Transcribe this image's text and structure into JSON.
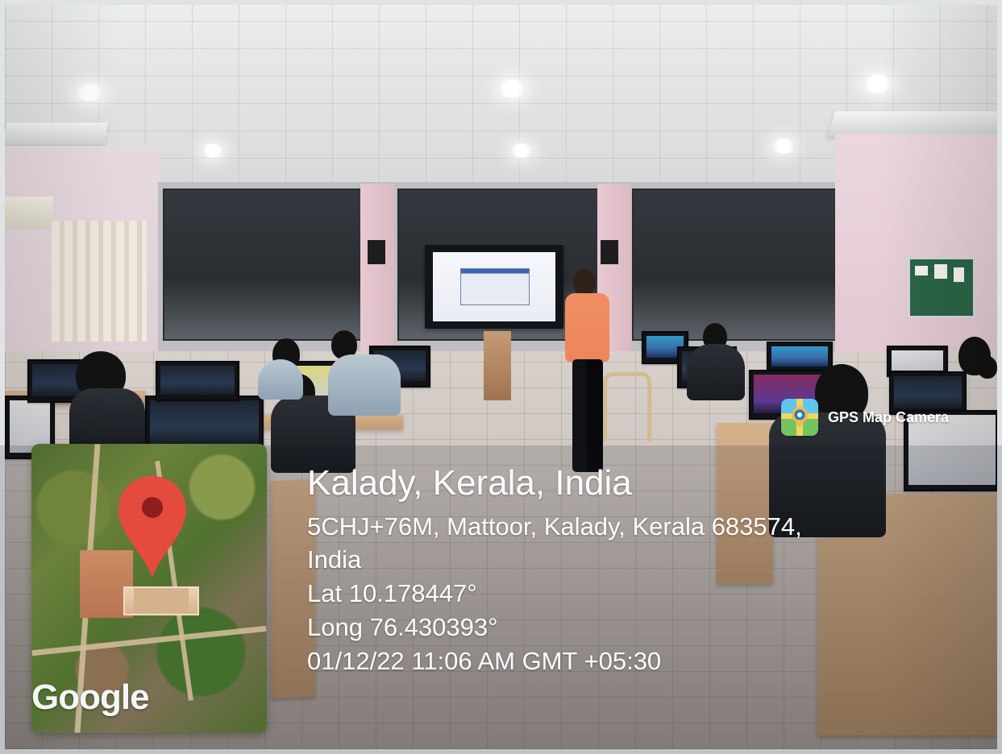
{
  "watermark": {
    "app_name": "GPS Map Camera",
    "map_label": "Google"
  },
  "location": {
    "title": "Kalady, Kerala, India",
    "address_line_1": "5CHJ+76M, Mattoor, Kalady, Kerala 683574,",
    "address_line_2": "India",
    "latitude": "Lat 10.178447°",
    "longitude": "Long 76.430393°",
    "timestamp": "01/12/22 11:06 AM GMT +05:30"
  },
  "icons": {
    "brand_icon": "gps-map-camera-icon",
    "map_pin": "map-pin-icon"
  },
  "colors": {
    "pin_red": "#e54b3c",
    "overlay_text": "#ffffff"
  }
}
